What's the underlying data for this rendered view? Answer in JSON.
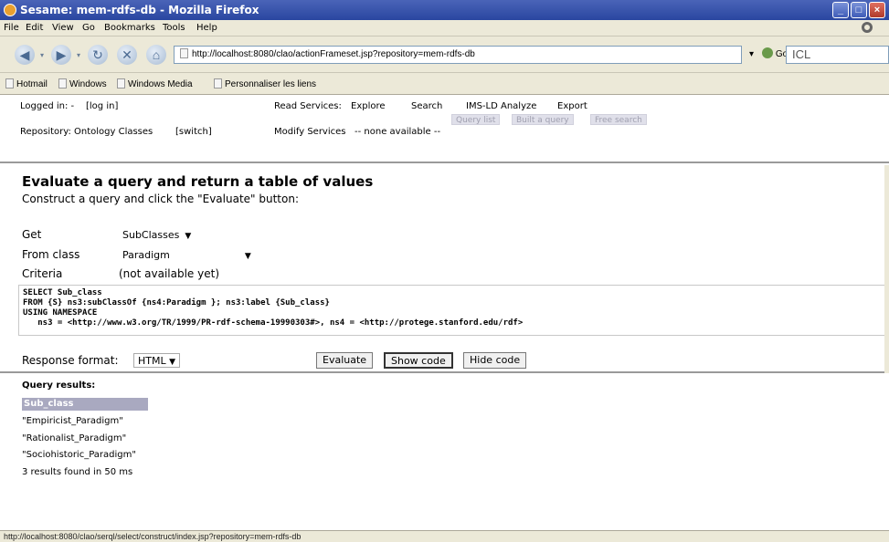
{
  "window": {
    "title": "Sesame: mem-rdfs-db - Mozilla Firefox",
    "controls": [
      "_",
      "□",
      "×"
    ]
  },
  "menu": [
    "File",
    "Edit",
    "View",
    "Go",
    "Bookmarks",
    "Tools",
    "Help"
  ],
  "nav": {
    "url": "http://localhost:8080/clao/actionFrameset.jsp?repository=mem-rdfs-db",
    "go_label": "Go",
    "search_value": "ICL"
  },
  "bookmarks": [
    "Hotmail",
    "Windows",
    "Windows Media",
    "Personnaliser les liens"
  ],
  "header": {
    "logged_in_label": "Logged in: -",
    "login_link": "[log in]",
    "repository_label": "Repository: Ontology Classes",
    "switch_link": "[switch]",
    "read_services_label": "Read Services:",
    "read_services": [
      "Explore",
      "Search",
      "IMS-LD Analyze",
      "Export"
    ],
    "query_tabs": [
      "Query list",
      "Built a query",
      "Free search"
    ],
    "modify_services_label": "Modify Services",
    "modify_services_value": "-- none available --"
  },
  "main": {
    "title": "Evaluate a query and return a table of values",
    "subtitle": "Construct a query and click the \"Evaluate\" button:",
    "get_label": "Get",
    "get_value": "SubClasses",
    "from_label": "From class",
    "from_value": "Paradigm",
    "criteria_label": "Criteria",
    "criteria_value": "(not available yet)",
    "query_text": "SELECT Sub_class\nFROM {S} ns3:subClassOf {ns4:Paradigm }; ns3:label {Sub_class}\nUSING NAMESPACE\n   ns3 = <http://www.w3.org/TR/1999/PR-rdf-schema-19990303#>, ns4 = <http://protege.stanford.edu/rdf>",
    "response_label": "Response format:",
    "response_value": "HTML",
    "buttons": {
      "evaluate": "Evaluate",
      "show_code": "Show code",
      "hide_code": "Hide code"
    }
  },
  "results": {
    "heading": "Query results:",
    "column": "Sub_class",
    "rows": [
      "\"Empiricist_Paradigm\"",
      "\"Rationalist_Paradigm\"",
      "\"Sociohistoric_Paradigm\""
    ],
    "summary": "3 results found in 50 ms"
  },
  "status": {
    "text": "http://localhost:8080/clao/serql/select/construct/index.jsp?repository=mem-rdfs-db"
  }
}
